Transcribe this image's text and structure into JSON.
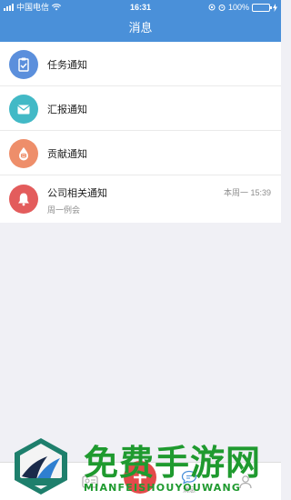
{
  "status_bar": {
    "carrier": "中国电信",
    "time": "16:31",
    "battery": "100%",
    "battery_level": 1.0
  },
  "header": {
    "title": "消息"
  },
  "messages": [
    {
      "label": "任务通知",
      "icon": "clipboard-check-icon",
      "color": "#5b8fdc"
    },
    {
      "label": "汇报通知",
      "icon": "envelope-icon",
      "color": "#42b9c6"
    },
    {
      "label": "贡献通知",
      "icon": "drop-coin-icon",
      "color": "#ee8e6a"
    },
    {
      "label": "公司相关通知",
      "icon": "bell-icon",
      "color": "#e35c5c",
      "time": "本周一 15:39",
      "preview": "周一例会"
    }
  ],
  "tabbar": {
    "tabs": [
      {
        "icon": "contacts-icon"
      },
      {
        "icon": "add-icon",
        "color": "#e34b4b"
      },
      {
        "icon": "message-icon"
      },
      {
        "icon": "profile-icon"
      }
    ],
    "active_label": "消息"
  },
  "watermark": {
    "text": "免费手游网",
    "sub": "MIANFEISHOUYOUWANG",
    "color": "#1f9a2f"
  }
}
